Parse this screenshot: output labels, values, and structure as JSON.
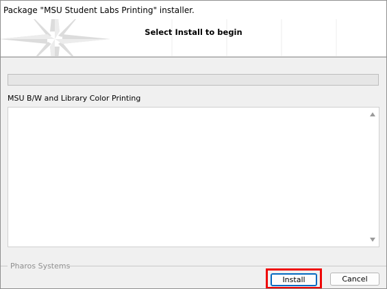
{
  "window": {
    "title": "Package \"MSU Student Labs Printing\" installer."
  },
  "banner": {
    "heading": "Select Install to begin",
    "logo_icon": "compass-star-icon"
  },
  "progress": {
    "value": 0,
    "fill_color": "#06b025"
  },
  "package": {
    "name": "MSU B/W and Library Color Printing"
  },
  "log": {
    "lines": []
  },
  "footer": {
    "brand": "Pharos Systems",
    "install_label": "Install",
    "cancel_label": "Cancel"
  },
  "colors": {
    "highlight_border": "#ee0000",
    "focus_border": "#0067c0"
  }
}
